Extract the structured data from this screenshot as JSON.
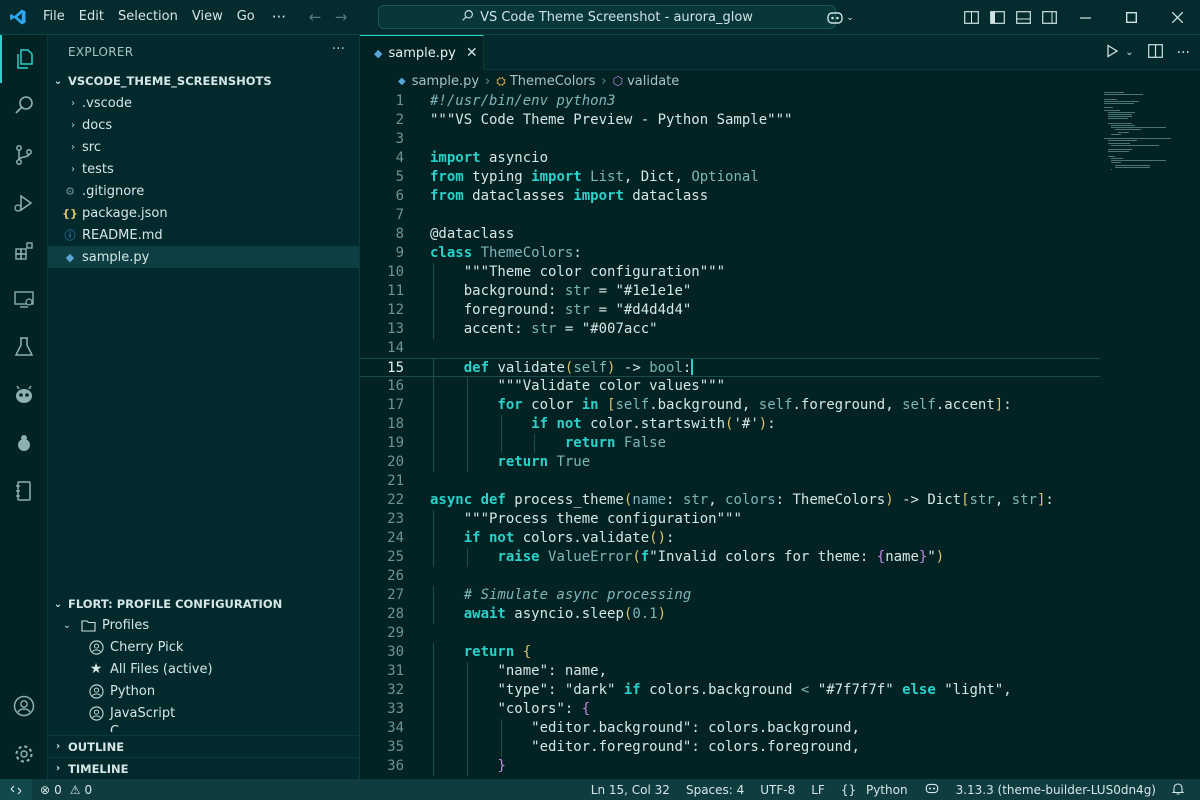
{
  "titlebar": {
    "menu": [
      "File",
      "Edit",
      "Selection",
      "View",
      "Go"
    ],
    "more": "···",
    "search_text": "VS Code Theme Screenshot - aurora_glow"
  },
  "sidebar": {
    "header": "EXPLORER",
    "more": "···",
    "root": "VSCODE_THEME_SCREENSHOTS",
    "folders": [
      ".vscode",
      "docs",
      "src",
      "tests"
    ],
    "files": [
      {
        "name": ".gitignore",
        "icon": "gear-icon",
        "glyph": "⚙"
      },
      {
        "name": "package.json",
        "icon": "braces-icon",
        "glyph": "{}"
      },
      {
        "name": "README.md",
        "icon": "info-icon",
        "glyph": "ⓘ"
      },
      {
        "name": "sample.py",
        "icon": "python-icon",
        "glyph": "◆"
      }
    ],
    "profile_section": "FLORT: PROFILE CONFIGURATION",
    "profiles_folder": "Profiles",
    "profiles": [
      {
        "name": "Cherry Pick",
        "icon": "account-icon"
      },
      {
        "name": "All Files (active)",
        "icon": "star-icon"
      },
      {
        "name": "Python",
        "icon": "account-icon"
      },
      {
        "name": "JavaScript",
        "icon": "account-icon"
      }
    ],
    "profile_cut": "C...",
    "outline": "OUTLINE",
    "timeline": "TIMELINE"
  },
  "editor": {
    "tab": "sample.py",
    "breadcrumb": [
      "sample.py",
      "ThemeColors",
      "validate"
    ],
    "current_line": 15,
    "lines": [
      [
        [
          "c",
          "#!/usr/bin/env python3"
        ]
      ],
      [
        [
          "s",
          "\"\"\"VS Code Theme Preview - Python Sample\"\"\""
        ]
      ],
      [],
      [
        [
          "k",
          "import"
        ],
        [
          "",
          " asyncio"
        ]
      ],
      [
        [
          "k",
          "from"
        ],
        [
          "",
          " typing "
        ],
        [
          "k",
          "import"
        ],
        [
          "t",
          " List"
        ],
        [
          "",
          ", Dict, "
        ],
        [
          "t",
          "Optional"
        ]
      ],
      [
        [
          "k",
          "from"
        ],
        [
          "",
          " dataclasses "
        ],
        [
          "k",
          "import"
        ],
        [
          "",
          " dataclass"
        ]
      ],
      [],
      [
        [
          "",
          "@dataclass"
        ]
      ],
      [
        [
          "k",
          "class"
        ],
        [
          "t",
          " ThemeColors"
        ],
        [
          "",
          ":"
        ]
      ],
      [
        [
          "",
          "    "
        ],
        [
          "s",
          "\"\"\"Theme color configuration\"\"\""
        ]
      ],
      [
        [
          "",
          "    background: "
        ],
        [
          "t",
          "str"
        ],
        [
          "",
          " = "
        ],
        [
          "s",
          "\"#1e1e1e\""
        ]
      ],
      [
        [
          "",
          "    foreground: "
        ],
        [
          "t",
          "str"
        ],
        [
          "",
          " = "
        ],
        [
          "s",
          "\"#d4d4d4\""
        ]
      ],
      [
        [
          "",
          "    accent: "
        ],
        [
          "t",
          "str"
        ],
        [
          "",
          " = "
        ],
        [
          "s",
          "\"#007acc\""
        ]
      ],
      [],
      [
        [
          "",
          "    "
        ],
        [
          "k",
          "def"
        ],
        [
          "",
          " validate"
        ],
        [
          "p",
          "("
        ],
        [
          "t",
          "self"
        ],
        [
          "p",
          ")"
        ],
        [
          "",
          " -> "
        ],
        [
          "t",
          "bool"
        ],
        [
          "",
          ":"
        ]
      ],
      [
        [
          "",
          "        "
        ],
        [
          "s",
          "\"\"\"Validate color values\"\"\""
        ]
      ],
      [
        [
          "",
          "        "
        ],
        [
          "k",
          "for"
        ],
        [
          "",
          " color "
        ],
        [
          "k",
          "in"
        ],
        [
          "p",
          " ["
        ],
        [
          "t",
          "self"
        ],
        [
          "",
          ".background, "
        ],
        [
          "t",
          "self"
        ],
        [
          "",
          ".foreground, "
        ],
        [
          "t",
          "self"
        ],
        [
          "",
          ".accent"
        ],
        [
          "p",
          "]"
        ],
        [
          "",
          ":"
        ]
      ],
      [
        [
          "",
          "            "
        ],
        [
          "k",
          "if not"
        ],
        [
          "",
          " color.startswith"
        ],
        [
          "p",
          "("
        ],
        [
          "s",
          "'#'"
        ],
        [
          "p",
          ")"
        ],
        [
          "",
          ":"
        ]
      ],
      [
        [
          "",
          "                "
        ],
        [
          "k",
          "return"
        ],
        [
          "t",
          " False"
        ]
      ],
      [
        [
          "",
          "        "
        ],
        [
          "k",
          "return"
        ],
        [
          "t",
          " True"
        ]
      ],
      [],
      [
        [
          "k",
          "async def"
        ],
        [
          "",
          " process_theme"
        ],
        [
          "p",
          "("
        ],
        [
          "t",
          "name"
        ],
        [
          "",
          ": "
        ],
        [
          "t",
          "str"
        ],
        [
          "",
          ", "
        ],
        [
          "t",
          "colors"
        ],
        [
          "",
          ": ThemeColors"
        ],
        [
          "p",
          ")"
        ],
        [
          "",
          " -> Dict"
        ],
        [
          "p",
          "["
        ],
        [
          "t",
          "str"
        ],
        [
          "",
          ", "
        ],
        [
          "t",
          "str"
        ],
        [
          "p",
          "]"
        ],
        [
          "",
          ":"
        ]
      ],
      [
        [
          "",
          "    "
        ],
        [
          "s",
          "\"\"\"Process theme configuration\"\"\""
        ]
      ],
      [
        [
          "",
          "    "
        ],
        [
          "k",
          "if not"
        ],
        [
          "",
          " colors.validate"
        ],
        [
          "p",
          "()"
        ],
        [
          "",
          ":"
        ]
      ],
      [
        [
          "",
          "        "
        ],
        [
          "k",
          "raise"
        ],
        [
          "t",
          " ValueError"
        ],
        [
          "p",
          "("
        ],
        [
          "k",
          "f"
        ],
        [
          "s",
          "\"Invalid colors for theme: "
        ],
        [
          "b",
          "{"
        ],
        [
          "",
          "name"
        ],
        [
          "b",
          "}"
        ],
        [
          "s",
          "\""
        ],
        [
          "p",
          ")"
        ]
      ],
      [],
      [
        [
          "",
          "    "
        ],
        [
          "c",
          "# Simulate async processing"
        ]
      ],
      [
        [
          "",
          "    "
        ],
        [
          "k",
          "await"
        ],
        [
          "",
          " asyncio.sleep"
        ],
        [
          "p",
          "("
        ],
        [
          "t",
          "0.1"
        ],
        [
          "p",
          ")"
        ]
      ],
      [],
      [
        [
          "",
          "    "
        ],
        [
          "k",
          "return"
        ],
        [
          "p",
          " {"
        ]
      ],
      [
        [
          "",
          "        "
        ],
        [
          "s",
          "\"name\""
        ],
        [
          "",
          ": name,"
        ]
      ],
      [
        [
          "",
          "        "
        ],
        [
          "s",
          "\"type\""
        ],
        [
          "",
          ": "
        ],
        [
          "s",
          "\"dark\""
        ],
        [
          "k",
          " if"
        ],
        [
          "",
          " colors.background "
        ],
        [
          "t",
          "<"
        ],
        [
          "s",
          " \"#7f7f7f\""
        ],
        [
          "k",
          " else"
        ],
        [
          "s",
          " \"light\""
        ],
        [
          "",
          ","
        ]
      ],
      [
        [
          "",
          "        "
        ],
        [
          "s",
          "\"colors\""
        ],
        [
          "",
          ": "
        ],
        [
          "b",
          "{"
        ]
      ],
      [
        [
          "",
          "            "
        ],
        [
          "s",
          "\"editor.background\""
        ],
        [
          "",
          ": colors.background,"
        ]
      ],
      [
        [
          "",
          "            "
        ],
        [
          "s",
          "\"editor.foreground\""
        ],
        [
          "",
          ": colors.foreground,"
        ]
      ],
      [
        [
          "",
          "        "
        ],
        [
          "b",
          "}"
        ]
      ]
    ]
  },
  "statusbar": {
    "errors": "0",
    "warnings": "0",
    "position": "Ln 15, Col 32",
    "spaces": "Spaces: 4",
    "encoding": "UTF-8",
    "eol": "LF",
    "language": "Python",
    "interpreter": "3.13.3 (theme-builder-LUS0dn4g)"
  },
  "colors": {
    "accent": "#2ad2c9",
    "background": "#022224",
    "statusbar": "#0e3c3f"
  }
}
